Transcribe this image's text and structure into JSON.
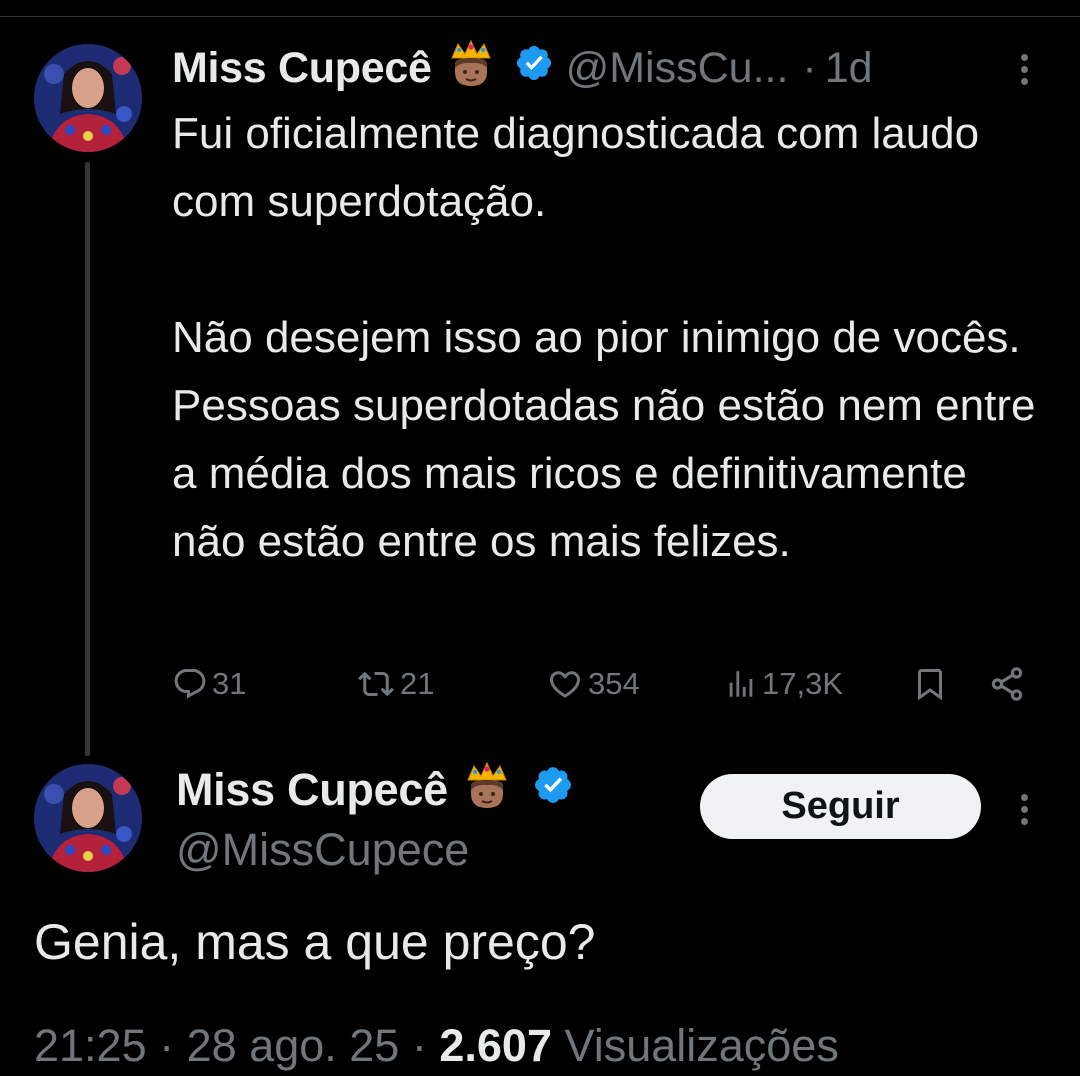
{
  "original_tweet": {
    "author_name": "Miss Cupecê",
    "author_handle": "@MissCu...",
    "separator": "·",
    "time_ago": "1d",
    "text_paragraphs": [
      "Fui oficialmente diagnosticada com laudo com superdotação.",
      "Não desejem isso ao pior inimigo de vocês. Pessoas superdotadas não estão nem entre a média dos mais ricos e definitivamente não estão entre os mais felizes."
    ],
    "actions": {
      "replies": "31",
      "retweets": "21",
      "likes": "354",
      "views": "17,3K"
    }
  },
  "reply_tweet": {
    "author_name": "Miss Cupecê",
    "author_handle": "@MissCupece",
    "follow_label": "Seguir",
    "text": "Genia, mas a que preço?",
    "time": "21:25",
    "date": "28 ago. 25",
    "views_count": "2.607",
    "views_label": "Visualizações"
  },
  "icons": {
    "crown": "crown-emoji-icon",
    "verified": "verified-badge-icon",
    "reply": "reply-icon",
    "retweet": "retweet-icon",
    "like": "heart-icon",
    "views": "analytics-icon",
    "bookmark": "bookmark-icon",
    "share": "share-icon",
    "more": "more-icon"
  },
  "colors": {
    "background": "#000000",
    "text": "#e7e9ea",
    "muted": "#71767b",
    "verified": "#1d9bf0",
    "follow_button_bg": "#eff3f4"
  }
}
